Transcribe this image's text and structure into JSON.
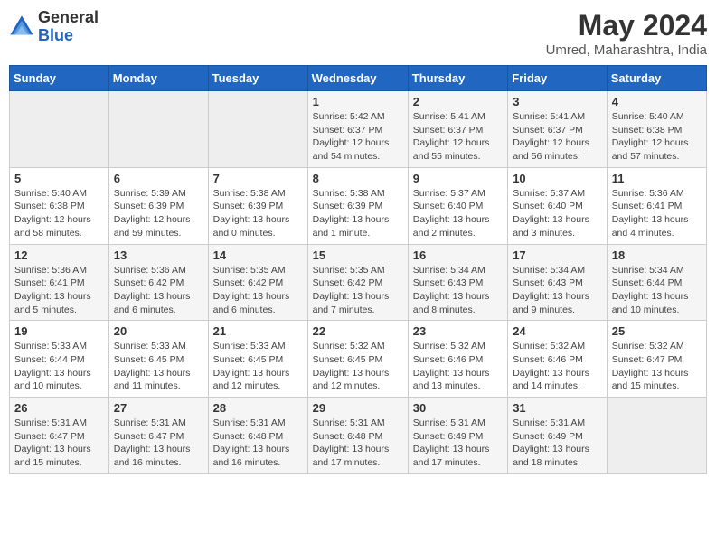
{
  "header": {
    "logo_general": "General",
    "logo_blue": "Blue",
    "month_year": "May 2024",
    "location": "Umred, Maharashtra, India"
  },
  "days_of_week": [
    "Sunday",
    "Monday",
    "Tuesday",
    "Wednesday",
    "Thursday",
    "Friday",
    "Saturday"
  ],
  "rows": [
    [
      {
        "num": "",
        "sunrise": "",
        "sunset": "",
        "daylight": ""
      },
      {
        "num": "",
        "sunrise": "",
        "sunset": "",
        "daylight": ""
      },
      {
        "num": "",
        "sunrise": "",
        "sunset": "",
        "daylight": ""
      },
      {
        "num": "1",
        "sunrise": "5:42 AM",
        "sunset": "6:37 PM",
        "daylight": "12 hours and 54 minutes."
      },
      {
        "num": "2",
        "sunrise": "5:41 AM",
        "sunset": "6:37 PM",
        "daylight": "12 hours and 55 minutes."
      },
      {
        "num": "3",
        "sunrise": "5:41 AM",
        "sunset": "6:37 PM",
        "daylight": "12 hours and 56 minutes."
      },
      {
        "num": "4",
        "sunrise": "5:40 AM",
        "sunset": "6:38 PM",
        "daylight": "12 hours and 57 minutes."
      }
    ],
    [
      {
        "num": "5",
        "sunrise": "5:40 AM",
        "sunset": "6:38 PM",
        "daylight": "12 hours and 58 minutes."
      },
      {
        "num": "6",
        "sunrise": "5:39 AM",
        "sunset": "6:39 PM",
        "daylight": "12 hours and 59 minutes."
      },
      {
        "num": "7",
        "sunrise": "5:38 AM",
        "sunset": "6:39 PM",
        "daylight": "13 hours and 0 minutes."
      },
      {
        "num": "8",
        "sunrise": "5:38 AM",
        "sunset": "6:39 PM",
        "daylight": "13 hours and 1 minute."
      },
      {
        "num": "9",
        "sunrise": "5:37 AM",
        "sunset": "6:40 PM",
        "daylight": "13 hours and 2 minutes."
      },
      {
        "num": "10",
        "sunrise": "5:37 AM",
        "sunset": "6:40 PM",
        "daylight": "13 hours and 3 minutes."
      },
      {
        "num": "11",
        "sunrise": "5:36 AM",
        "sunset": "6:41 PM",
        "daylight": "13 hours and 4 minutes."
      }
    ],
    [
      {
        "num": "12",
        "sunrise": "5:36 AM",
        "sunset": "6:41 PM",
        "daylight": "13 hours and 5 minutes."
      },
      {
        "num": "13",
        "sunrise": "5:36 AM",
        "sunset": "6:42 PM",
        "daylight": "13 hours and 6 minutes."
      },
      {
        "num": "14",
        "sunrise": "5:35 AM",
        "sunset": "6:42 PM",
        "daylight": "13 hours and 6 minutes."
      },
      {
        "num": "15",
        "sunrise": "5:35 AM",
        "sunset": "6:42 PM",
        "daylight": "13 hours and 7 minutes."
      },
      {
        "num": "16",
        "sunrise": "5:34 AM",
        "sunset": "6:43 PM",
        "daylight": "13 hours and 8 minutes."
      },
      {
        "num": "17",
        "sunrise": "5:34 AM",
        "sunset": "6:43 PM",
        "daylight": "13 hours and 9 minutes."
      },
      {
        "num": "18",
        "sunrise": "5:34 AM",
        "sunset": "6:44 PM",
        "daylight": "13 hours and 10 minutes."
      }
    ],
    [
      {
        "num": "19",
        "sunrise": "5:33 AM",
        "sunset": "6:44 PM",
        "daylight": "13 hours and 10 minutes."
      },
      {
        "num": "20",
        "sunrise": "5:33 AM",
        "sunset": "6:45 PM",
        "daylight": "13 hours and 11 minutes."
      },
      {
        "num": "21",
        "sunrise": "5:33 AM",
        "sunset": "6:45 PM",
        "daylight": "13 hours and 12 minutes."
      },
      {
        "num": "22",
        "sunrise": "5:32 AM",
        "sunset": "6:45 PM",
        "daylight": "13 hours and 12 minutes."
      },
      {
        "num": "23",
        "sunrise": "5:32 AM",
        "sunset": "6:46 PM",
        "daylight": "13 hours and 13 minutes."
      },
      {
        "num": "24",
        "sunrise": "5:32 AM",
        "sunset": "6:46 PM",
        "daylight": "13 hours and 14 minutes."
      },
      {
        "num": "25",
        "sunrise": "5:32 AM",
        "sunset": "6:47 PM",
        "daylight": "13 hours and 15 minutes."
      }
    ],
    [
      {
        "num": "26",
        "sunrise": "5:31 AM",
        "sunset": "6:47 PM",
        "daylight": "13 hours and 15 minutes."
      },
      {
        "num": "27",
        "sunrise": "5:31 AM",
        "sunset": "6:47 PM",
        "daylight": "13 hours and 16 minutes."
      },
      {
        "num": "28",
        "sunrise": "5:31 AM",
        "sunset": "6:48 PM",
        "daylight": "13 hours and 16 minutes."
      },
      {
        "num": "29",
        "sunrise": "5:31 AM",
        "sunset": "6:48 PM",
        "daylight": "13 hours and 17 minutes."
      },
      {
        "num": "30",
        "sunrise": "5:31 AM",
        "sunset": "6:49 PM",
        "daylight": "13 hours and 17 minutes."
      },
      {
        "num": "31",
        "sunrise": "5:31 AM",
        "sunset": "6:49 PM",
        "daylight": "13 hours and 18 minutes."
      },
      {
        "num": "",
        "sunrise": "",
        "sunset": "",
        "daylight": ""
      }
    ]
  ]
}
